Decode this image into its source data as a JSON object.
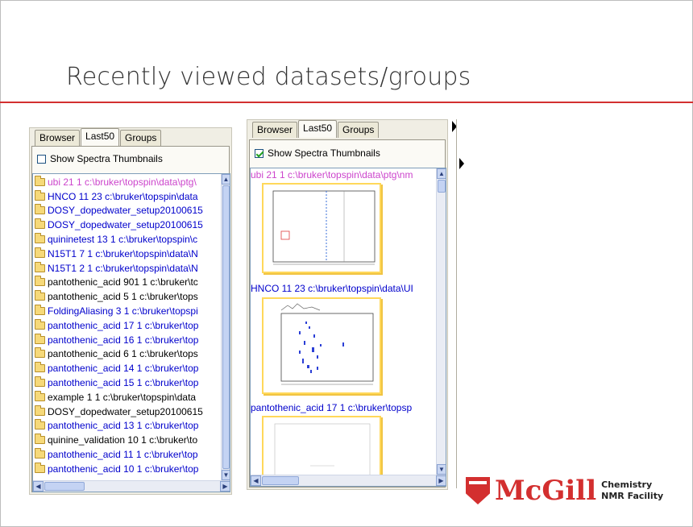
{
  "slide": {
    "title": "Recently viewed datasets/groups"
  },
  "colors": {
    "accent_red": "#d32f2f",
    "link_blue": "#0000cc",
    "magenta": "#cc44cc",
    "thumbnail_border": "#ffd85a"
  },
  "left_panel": {
    "tabs": [
      {
        "label": "Browser",
        "active": false
      },
      {
        "label": "Last50",
        "active": true
      },
      {
        "label": "Groups",
        "active": false
      }
    ],
    "show_thumbnails_label": "Show Spectra Thumbnails",
    "show_thumbnails_checked": false,
    "items": [
      {
        "text": "ubi  21  1  c:\\bruker\\topspin\\data\\ptg\\",
        "color": "#cc44cc",
        "icon": "folder-icon"
      },
      {
        "text": "HNCO  11  23  c:\\bruker\\topspin\\data",
        "color": "#0000cc",
        "icon": "folder-icon"
      },
      {
        "text": "DOSY_dopedwater_setup20100615",
        "color": "#0000cc",
        "icon": "folder-icon"
      },
      {
        "text": "DOSY_dopedwater_setup20100615",
        "color": "#0000cc",
        "icon": "folder-icon"
      },
      {
        "text": "quininetest  13  1  c:\\bruker\\topspin\\c",
        "color": "#0000cc",
        "icon": "folder-icon"
      },
      {
        "text": "N15T1  7  1  c:\\bruker\\topspin\\data\\N",
        "color": "#0000cc",
        "icon": "folder-icon"
      },
      {
        "text": "N15T1  2  1  c:\\bruker\\topspin\\data\\N",
        "color": "#0000cc",
        "icon": "folder-icon"
      },
      {
        "text": "pantothenic_acid  901  1  c:\\bruker\\tc",
        "color": "#000000",
        "icon": "folder-icon"
      },
      {
        "text": "pantothenic_acid  5  1  c:\\bruker\\tops",
        "color": "#000000",
        "icon": "folder-icon"
      },
      {
        "text": "FoldingAliasing  3  1  c:\\bruker\\topspi",
        "color": "#0000cc",
        "icon": "folder-icon"
      },
      {
        "text": "pantothenic_acid  17  1  c:\\bruker\\top",
        "color": "#0000cc",
        "icon": "folder-icon"
      },
      {
        "text": "pantothenic_acid  16  1  c:\\bruker\\top",
        "color": "#0000cc",
        "icon": "folder-icon"
      },
      {
        "text": "pantothenic_acid  6  1  c:\\bruker\\tops",
        "color": "#000000",
        "icon": "folder-icon"
      },
      {
        "text": "pantothenic_acid  14  1  c:\\bruker\\top",
        "color": "#0000cc",
        "icon": "folder-icon"
      },
      {
        "text": "pantothenic_acid  15  1  c:\\bruker\\top",
        "color": "#0000cc",
        "icon": "folder-icon"
      },
      {
        "text": "example  1  1  c:\\bruker\\topspin\\data",
        "color": "#000000",
        "icon": "folder-icon"
      },
      {
        "text": "DOSY_dopedwater_setup20100615",
        "color": "#000000",
        "icon": "folder-icon"
      },
      {
        "text": "pantothenic_acid  13  1  c:\\bruker\\top",
        "color": "#0000cc",
        "icon": "folder-icon"
      },
      {
        "text": "quinine_validation  10  1  c:\\bruker\\to",
        "color": "#000000",
        "icon": "folder-icon"
      },
      {
        "text": "pantothenic_acid  11  1  c:\\bruker\\top",
        "color": "#0000cc",
        "icon": "folder-icon"
      },
      {
        "text": "pantothenic_acid  10  1  c:\\bruker\\top",
        "color": "#0000cc",
        "icon": "folder-icon"
      }
    ]
  },
  "right_panel": {
    "tabs": [
      {
        "label": "Browser",
        "active": false
      },
      {
        "label": "Last50",
        "active": true
      },
      {
        "label": "Groups",
        "active": false
      }
    ],
    "show_thumbnails_label": "Show Spectra Thumbnails",
    "show_thumbnails_checked": true,
    "thumbnails": [
      {
        "title": "ubi  21  1  c:\\bruker\\topspin\\data\\ptg\\nm",
        "color": "#cc44cc"
      },
      {
        "title": "HNCO  11  23  c:\\bruker\\topspin\\data\\UI",
        "color": "#0000cc"
      },
      {
        "title": "pantothenic_acid  17  1  c:\\bruker\\topsp",
        "color": "#0000cc"
      }
    ]
  },
  "logo": {
    "word": "McGill",
    "line1": "Chemistry",
    "line2": "NMR Facility"
  }
}
